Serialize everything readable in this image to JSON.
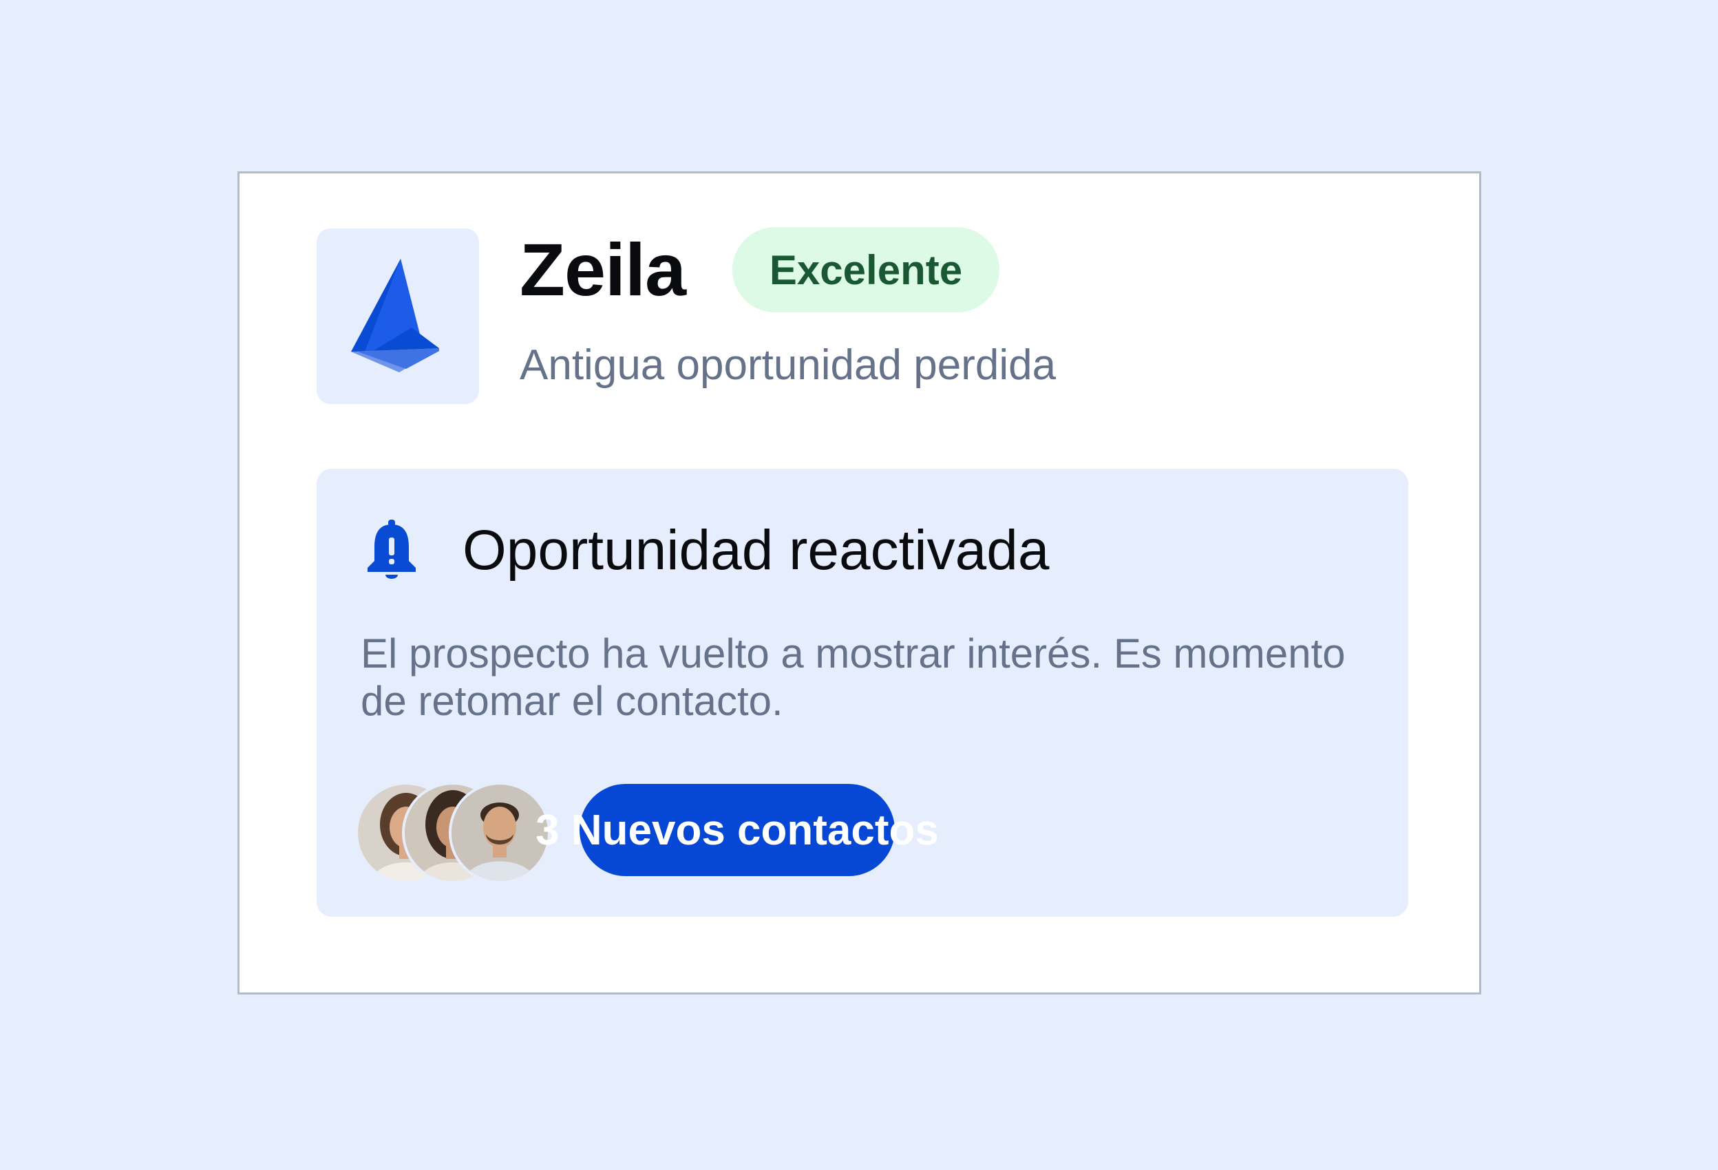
{
  "company": {
    "name": "Zeila",
    "rating": "Excelente",
    "subtitle": "Antigua oportunidad perdida",
    "logo_icon": "sail-logo-icon"
  },
  "alert": {
    "icon": "bell-alert-icon",
    "title": "Oportunidad reactivada",
    "body": "El prospecto ha vuelto a mostrar interés. Es momento de retomar el contacto.",
    "contacts_button": "3 Nuevos contactos",
    "avatars": [
      "avatar-woman-1",
      "avatar-woman-2",
      "avatar-man"
    ]
  },
  "colors": {
    "background": "#e6eefd",
    "accent": "#0647d6",
    "badge_bg": "#dcfae6",
    "badge_text": "#1a5733",
    "muted_text": "#65728a"
  }
}
